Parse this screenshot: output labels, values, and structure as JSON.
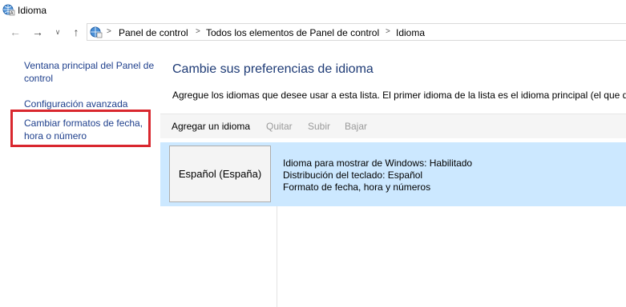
{
  "window": {
    "title": "Idioma",
    "icon": "globe-icon"
  },
  "nav": {
    "back_icon": "arrow-left-icon",
    "forward_icon": "arrow-right-icon",
    "recent_icon": "chevron-down-icon",
    "up_icon": "arrow-up-icon"
  },
  "breadcrumb": {
    "items": [
      "Panel de control",
      "Todos los elementos de Panel de control",
      "Idioma"
    ],
    "separator": ">"
  },
  "sidebar": {
    "items": [
      {
        "label": "Ventana principal del Panel de control"
      },
      {
        "label": "Configuración avanzada"
      },
      {
        "label": "Cambiar formatos de fecha, hora o número"
      }
    ],
    "highlight_color": "#d9272e"
  },
  "main": {
    "heading": "Cambie sus preferencias de idioma",
    "description": "Agregue los idiomas que desee usar a esta lista. El primer idioma de la lista es el idioma principal (el que des",
    "toolbar": {
      "add": "Agregar un idioma",
      "remove": "Quitar",
      "up": "Subir",
      "down": "Bajar"
    },
    "languages": [
      {
        "name": "Español (España)",
        "details": [
          "Idioma para mostrar de Windows: Habilitado",
          "Distribución del teclado: Español",
          "Formato de fecha, hora y números"
        ]
      }
    ]
  },
  "colors": {
    "link": "#1e3f8c",
    "heading": "#1d3a75",
    "selected_row": "#cce8ff",
    "disabled_text": "#9a9a9a"
  }
}
